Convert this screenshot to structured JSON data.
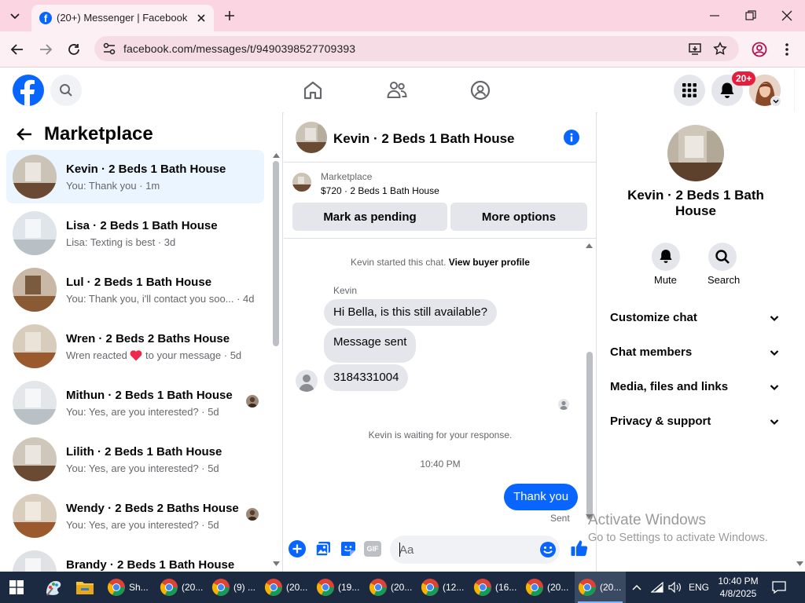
{
  "browser": {
    "tab_title": "(20+) Messenger | Facebook",
    "url": "facebook.com/messages/t/9490398527709393"
  },
  "header": {
    "notif_badge": "20+"
  },
  "left": {
    "title": "Marketplace",
    "conversations": [
      {
        "name": "Kevin · 2 Beds 1 Bath House",
        "sub": "You: Thank you · 1m",
        "selected": true
      },
      {
        "name": "Lisa · 2 Beds 1 Bath House",
        "sub": "Lisa: Texting is best · 3d"
      },
      {
        "name": "Lul · 2 Beds 1 Bath House",
        "sub": "You: Thank you, i'll contact you soo... · 4d"
      },
      {
        "name": "Wren · 2 Beds 2 Baths House",
        "sub_before": "Wren reacted",
        "sub_after": "to your message · 5d",
        "heart": true
      },
      {
        "name": "Mithun · 2 Beds 1 Bath House",
        "sub": "You: Yes, are you interested? · 5d",
        "mini_avatar": true
      },
      {
        "name": "Lilith · 2 Beds 1 Bath House",
        "sub": "You: Yes, are you interested? · 5d"
      },
      {
        "name": "Wendy · 2 Beds 2 Baths House",
        "sub": "You: Yes, are you interested? · 5d",
        "mini_avatar": true
      },
      {
        "name": "Brandy · 2 Beds 1 Bath House",
        "sub": ""
      }
    ]
  },
  "chat": {
    "title": "Kevin · 2 Beds 1 Bath House",
    "listing_label": "Marketplace",
    "listing_price": "$720 · 2 Beds 1 Bath House",
    "btn_pending": "Mark as pending",
    "btn_more": "More options",
    "started_text": "Kevin started this chat.",
    "view_profile": "View buyer profile",
    "sender_name": "Kevin",
    "messages_in": [
      "Hi Bella, is this still available?",
      "Message sent",
      "3184331004"
    ],
    "waiting": "Kevin is waiting for your response.",
    "time": "10:40 PM",
    "message_out": "Thank you",
    "sent_label": "Sent",
    "composer_placeholder": "Aa"
  },
  "details": {
    "name": "Kevin · 2 Beds 1 Bath House",
    "mute": "Mute",
    "search": "Search",
    "sections": [
      "Customize chat",
      "Chat members",
      "Media, files and links",
      "Privacy & support"
    ]
  },
  "watermark": {
    "line1": "Activate Windows",
    "line2": "Go to Settings to activate Windows."
  },
  "taskbar": {
    "items": [
      "Sh...",
      "(20...",
      "(9) ...",
      "(20...",
      "(19...",
      "(20...",
      "(12...",
      "(16...",
      "(20...",
      "(20..."
    ],
    "lang": "ENG",
    "clock_time": "10:40 PM",
    "clock_date": "4/8/2025"
  },
  "colors": {
    "fb_blue": "#0866ff",
    "selected_bg": "#ebf5ff",
    "notif_red": "#e41e3f",
    "tab_bar": "#fbd6e2"
  }
}
